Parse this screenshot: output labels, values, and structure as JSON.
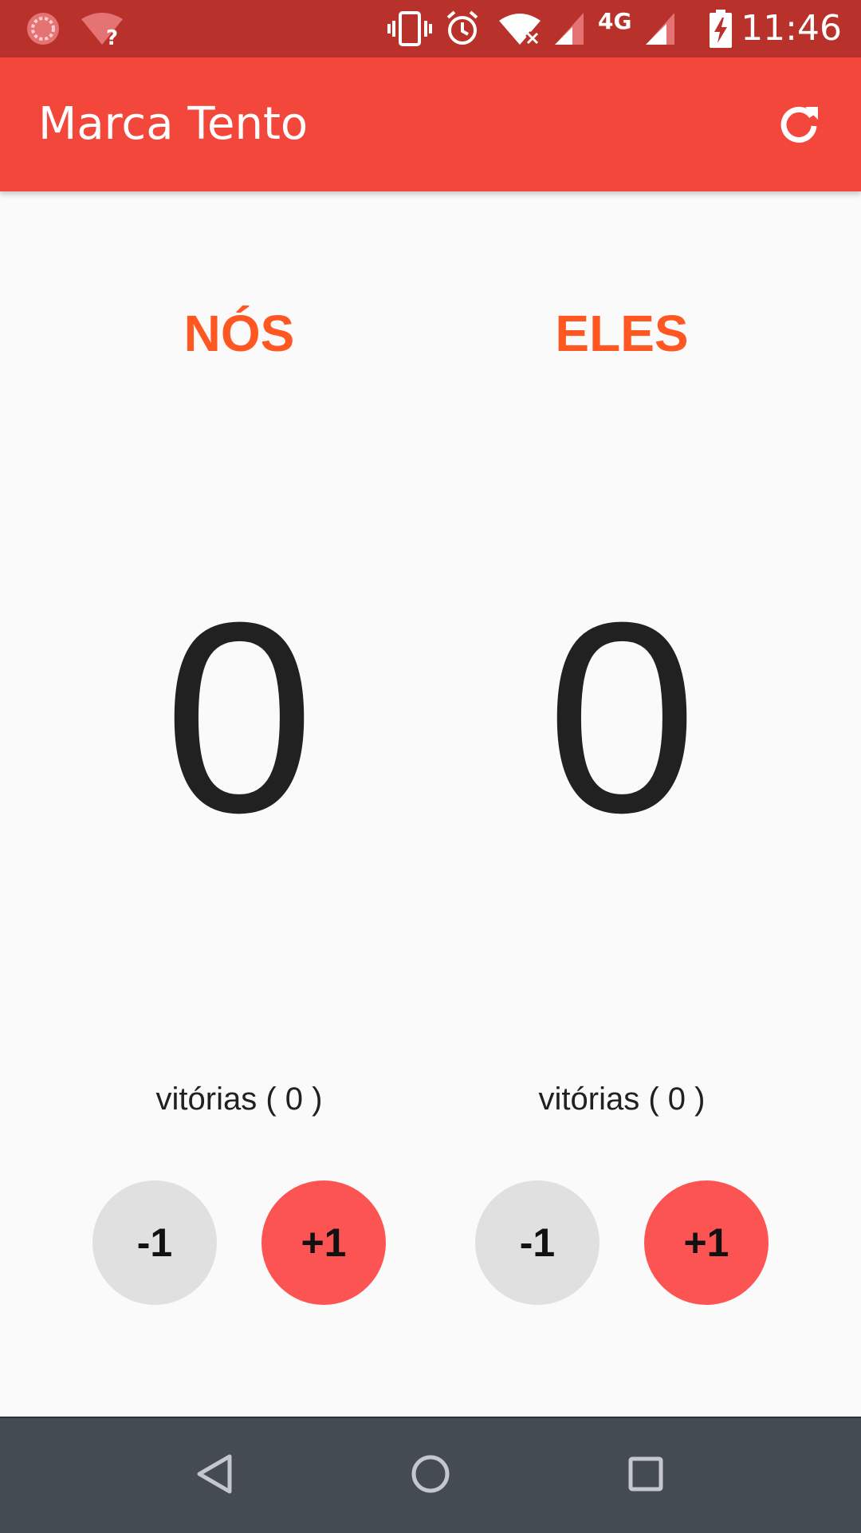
{
  "status_bar": {
    "time": "11:46",
    "network": "4G",
    "icons": [
      "app-notification-icon",
      "wifi-unknown-icon",
      "vibrate-icon",
      "alarm-icon",
      "wifi-off-icon",
      "signal-icon",
      "signal-icon",
      "battery-charging-icon"
    ]
  },
  "app_bar": {
    "title": "Marca Tento",
    "action_icon": "refresh-icon"
  },
  "teams": [
    {
      "name": "NÓS",
      "score": "0",
      "wins": "vitórias ( 0 )",
      "minus_label": "-1",
      "plus_label": "+1"
    },
    {
      "name": "ELES",
      "score": "0",
      "wins": "vitórias ( 0 )",
      "minus_label": "-1",
      "plus_label": "+1"
    }
  ],
  "nav_bar": {
    "icons": [
      "back-icon",
      "home-icon",
      "recents-icon"
    ]
  },
  "colors": {
    "status_bar": "#b8312a",
    "app_bar": "#f4473b",
    "team_name": "#ff5722",
    "plus_button": "#fc5353",
    "minus_button": "#e0e0e0",
    "nav_bar": "#444b52"
  }
}
